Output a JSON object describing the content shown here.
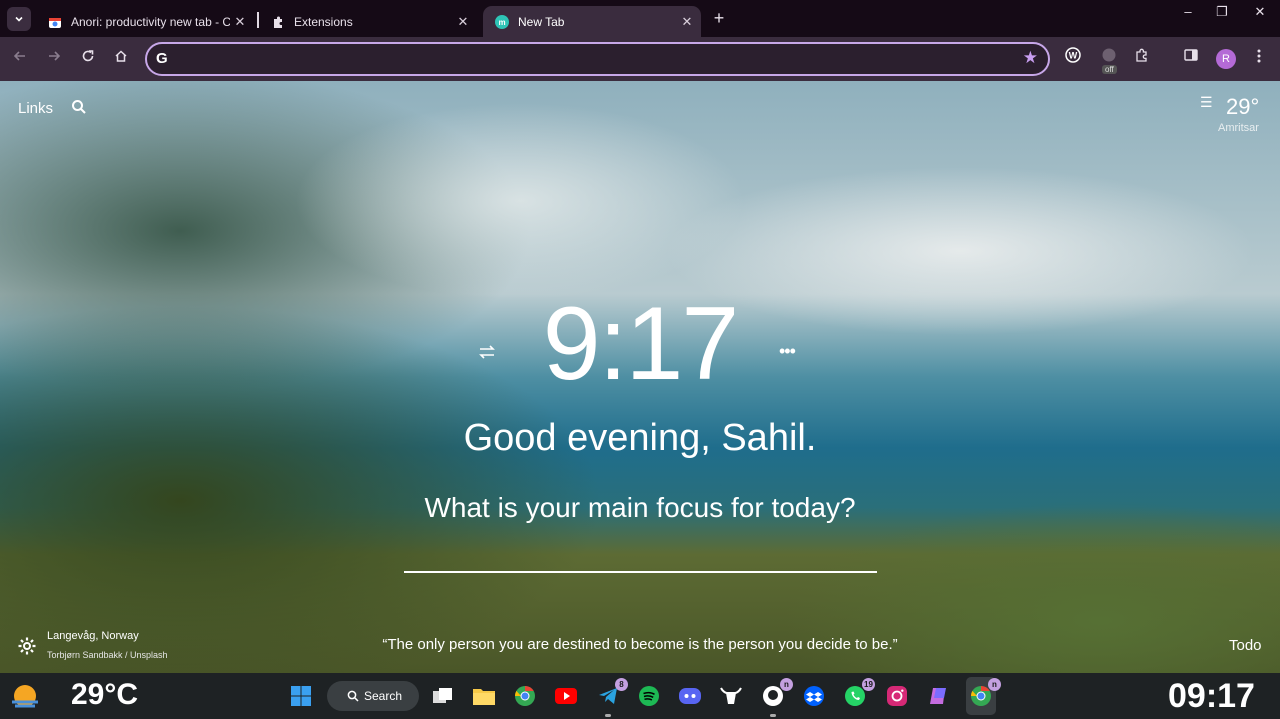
{
  "browser": {
    "tabs": [
      {
        "title": "Anori: productivity new tab - C",
        "favicon": "chrome-web-store-icon",
        "active": false
      },
      {
        "title": "Extensions",
        "favicon": "puzzle-icon",
        "active": false
      },
      {
        "title": "New Tab",
        "favicon": "anori-icon",
        "active": true
      }
    ],
    "window_controls": {
      "minimize": "–",
      "maximize": "❐",
      "close": "✕"
    },
    "omnibox": {
      "value": "",
      "placeholder": ""
    },
    "extension_badge": "off",
    "profile_initial": "R"
  },
  "page": {
    "links_label": "Links",
    "weather": {
      "temp": "29°",
      "city": "Amritsar"
    },
    "clock": "9:17",
    "greeting": "Good evening, Sahil.",
    "focus_question": "What is your main focus for today?",
    "focus_value": "",
    "photo": {
      "location": "Langevåg, Norway",
      "credit": "Torbjørn Sandbakk / Unsplash"
    },
    "quote": "“The only person you are destined to become is the person you decide to be.”",
    "todo_label": "Todo"
  },
  "taskbar": {
    "weather_temp": "29°C",
    "search_label": "Search",
    "badges": {
      "telegram": "8",
      "github": "n",
      "whatsapp": "19",
      "chrome": "n"
    },
    "clock": "09:17"
  },
  "colors": {
    "accent": "#c7a7e8",
    "toolbar": "#3a2c3e",
    "tabstrip": "#150a16",
    "taskbar": "#1e2224"
  }
}
